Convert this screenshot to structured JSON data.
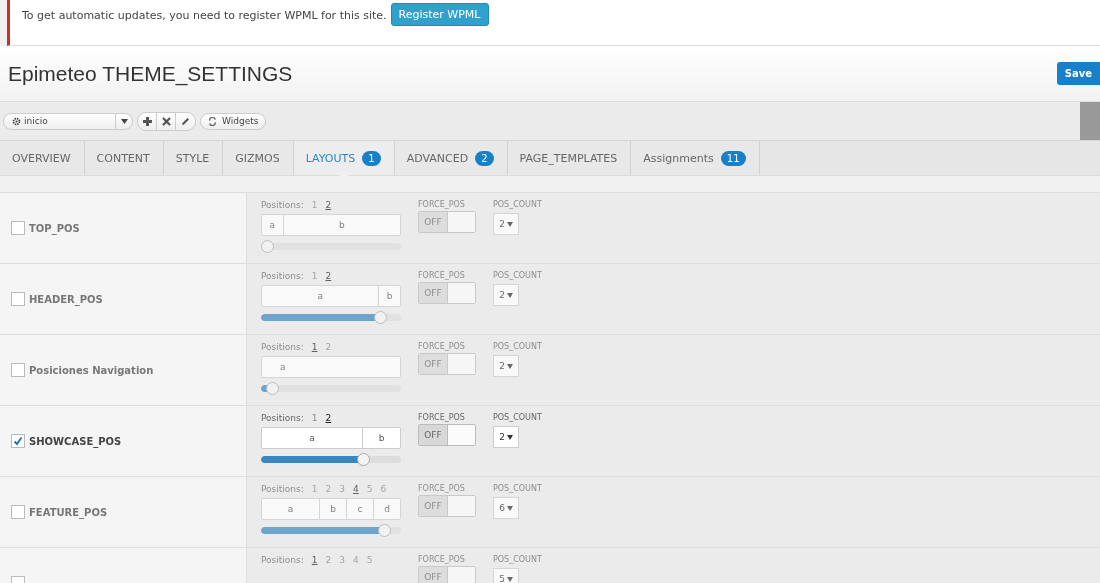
{
  "notice": {
    "text": "To get automatic updates, you need to register WPML for this site.",
    "button": "Register WPML"
  },
  "header": {
    "title": "Epimeteo THEME_SETTINGS",
    "save": "Save"
  },
  "toolbar": {
    "select": "inicio",
    "widgets": "Widgets"
  },
  "tabs": [
    {
      "label": "OVERVIEW",
      "selected": false
    },
    {
      "label": "CONTENT",
      "selected": false
    },
    {
      "label": "STYLE",
      "selected": false
    },
    {
      "label": "GIZMOS",
      "selected": false
    },
    {
      "label": "LAYOUTS",
      "badge": "1",
      "selected": true
    },
    {
      "label": "ADVANCED",
      "badge": "2",
      "selected": false
    },
    {
      "label": "PAGE_TEMPLATES",
      "selected": false
    },
    {
      "label": "Assignments",
      "badge": "11",
      "selected": false
    }
  ],
  "rows": [
    {
      "name": "TOP_POS",
      "checked": false,
      "positions_label": "Positions:",
      "positions": [
        {
          "label": "1",
          "selected": false
        },
        {
          "label": "2",
          "selected": true
        }
      ],
      "segments": [
        "a",
        "b"
      ],
      "level": 0.0,
      "force_label": "FORCE_POS",
      "force_state": "OFF",
      "force_on": false,
      "count_label": "POS_COUNT",
      "count": "2"
    },
    {
      "name": "HEADER_POS",
      "checked": false,
      "positions_label": "Positions:",
      "positions": [
        {
          "label": "1",
          "selected": false
        },
        {
          "label": "2",
          "selected": true
        }
      ],
      "segments": [
        "a",
        "b"
      ],
      "level": 0.85,
      "force_label": "FORCE_POS",
      "force_state": "OFF",
      "force_on": false,
      "count_label": "POS_COUNT",
      "count": "2"
    },
    {
      "name": "Posiciones Navigation",
      "checked": false,
      "positions_label": "Positions:",
      "positions": [
        {
          "label": "1",
          "selected": true
        },
        {
          "label": "2",
          "selected": false
        }
      ],
      "segments": [
        "a"
      ],
      "level": 0.08,
      "force_label": "FORCE_POS",
      "force_state": "OFF",
      "force_on": false,
      "count_label": "POS_COUNT",
      "count": "2"
    },
    {
      "name": "SHOWCASE_POS",
      "checked": true,
      "positions_label": "Positions:",
      "positions": [
        {
          "label": "1",
          "selected": false
        },
        {
          "label": "2",
          "selected": true
        }
      ],
      "segments": [
        "a",
        "b"
      ],
      "level": 0.73,
      "force_label": "FORCE_POS",
      "force_state": "OFF",
      "force_on": false,
      "count_label": "POS_COUNT",
      "count": "2"
    },
    {
      "name": "FEATURE_POS",
      "checked": false,
      "positions_label": "Positions:",
      "positions": [
        {
          "label": "1",
          "selected": false
        },
        {
          "label": "2",
          "selected": false
        },
        {
          "label": "3",
          "selected": false
        },
        {
          "label": "4",
          "selected": true
        },
        {
          "label": "5",
          "selected": false
        },
        {
          "label": "6",
          "selected": false
        }
      ],
      "segments": [
        "a",
        "b",
        "c",
        "d"
      ],
      "level": 0.88,
      "force_label": "FORCE_POS",
      "force_state": "OFF",
      "force_on": false,
      "count_label": "POS_COUNT",
      "count": "6"
    },
    {
      "checked": false,
      "positions_label": "Positions:",
      "positions": [
        {
          "label": "1",
          "selected": true
        },
        {
          "label": "2",
          "selected": false
        },
        {
          "label": "3",
          "selected": false
        },
        {
          "label": "4",
          "selected": false
        },
        {
          "label": "5",
          "selected": false
        }
      ],
      "force_label": "FORCE_POS",
      "force_state": "OFF",
      "force_on": false,
      "count_label": "POS_COUNT",
      "count": "5"
    }
  ]
}
